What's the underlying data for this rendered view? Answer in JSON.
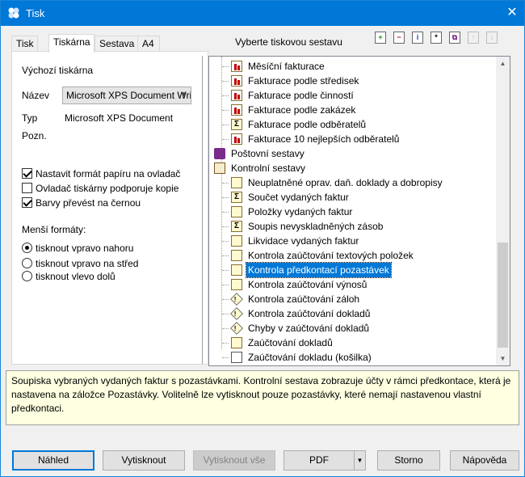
{
  "window": {
    "title": "Tisk",
    "close_glyph": "✕"
  },
  "tabs": [
    {
      "label": "Tisk"
    },
    {
      "label": "Tiskárna",
      "active": true
    },
    {
      "label": "Sestava"
    },
    {
      "label": "A4"
    }
  ],
  "printer": {
    "section_title": "Výchozí tiskárna",
    "name_label": "Název",
    "name_value": "Microsoft XPS Document Wri",
    "type_label": "Typ",
    "type_value": "Microsoft XPS Document",
    "note_label": "Pozn.",
    "checkboxes": [
      {
        "label": "Nastavit formát papíru na ovladač",
        "checked": true
      },
      {
        "label": "Ovladač tiskárny podporuje kopie",
        "checked": false
      },
      {
        "label": "Barvy převést na černou",
        "checked": true
      }
    ],
    "small_formats_title": "Menší formáty:",
    "radios": [
      {
        "label": "tisknout vpravo nahoru",
        "selected": true
      },
      {
        "label": "tisknout vpravo na střed",
        "selected": false
      },
      {
        "label": "tisknout vlevo dolů",
        "selected": false
      }
    ]
  },
  "report_tree": {
    "heading": "Vyberte tiskovou sestavu",
    "toolbar_icons": [
      "add-icon",
      "remove-icon",
      "info-icon",
      "edit-icon",
      "copy-icon",
      "move-up-icon",
      "move-down-icon"
    ],
    "items": [
      {
        "label": "Měsíční fakturace",
        "icon": "chart-icon"
      },
      {
        "label": "Fakturace podle středisek",
        "icon": "chart-icon"
      },
      {
        "label": "Fakturace podle činností",
        "icon": "chart-icon"
      },
      {
        "label": "Fakturace podle zakázek",
        "icon": "chart-icon"
      },
      {
        "label": "Fakturace podle odběratelů",
        "icon": "sum-icon"
      },
      {
        "label": "Fakturace 10 nejlepších odběratelů",
        "icon": "chart-icon"
      },
      {
        "label": "Poštovní sestavy",
        "icon": "book-icon",
        "folder": true
      },
      {
        "label": "Kontrolní sestavy",
        "icon": "book-open-icon",
        "folder": true
      },
      {
        "label": "Neuplatněné oprav. daň. doklady a dobropisy",
        "icon": "doc-icon"
      },
      {
        "label": "Součet vydaných faktur",
        "icon": "sum-icon"
      },
      {
        "label": "Položky vydaných faktur",
        "icon": "doc-icon"
      },
      {
        "label": "Soupis nevyskladněných zásob",
        "icon": "sum-icon"
      },
      {
        "label": "Likvidace vydaných faktur",
        "icon": "doc-icon"
      },
      {
        "label": "Kontrola zaúčtování textových položek",
        "icon": "doc-icon"
      },
      {
        "label": "Kontrola předkontací pozastávek",
        "icon": "doc-icon",
        "selected": true
      },
      {
        "label": "Kontrola zaúčtování výnosů",
        "icon": "doc-icon"
      },
      {
        "label": "Kontrola zaúčtování záloh",
        "icon": "warning-icon"
      },
      {
        "label": "Kontrola zaúčtování dokladů",
        "icon": "warning-icon"
      },
      {
        "label": "Chyby v zaúčtování dokladů",
        "icon": "warning-icon"
      },
      {
        "label": "Zaúčtování dokladů",
        "icon": "doc-icon"
      },
      {
        "label": "Zaúčtování dokladu (košilka)",
        "icon": "blank-doc-icon"
      }
    ]
  },
  "description": "Soupiska vybraných vydaných faktur s pozastávkami. Kontrolní sestava zobrazuje účty v rámci předkontace, která je nastavena na záložce Pozastávky. Volitelně lze vytisknout pouze pozastávky, které nemají nastavenou vlastní předkontaci.",
  "buttons": {
    "preview": "Náhled",
    "print": "Vytisknout",
    "print_all": "Vytisknout vše",
    "pdf": "PDF",
    "cancel": "Storno",
    "help": "Nápověda"
  }
}
